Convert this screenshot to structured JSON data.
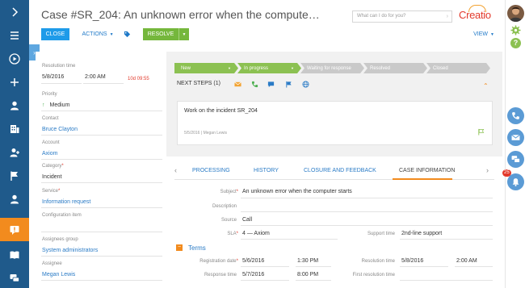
{
  "header": {
    "title": "Case #SR_204: An unknown error when the computer starts",
    "search_placeholder": "What can I do for you?",
    "logo": "Creatio"
  },
  "toolbar": {
    "close_label": "CLOSE",
    "actions_label": "ACTIONS",
    "resolve_label": "RESOLVE",
    "view_label": "VIEW"
  },
  "profile": {
    "resolution_time_label": "Resolution time",
    "resolution_date": "5/8/2016",
    "resolution_time": "2:00 AM",
    "overdue": "10d 09:55",
    "priority_label": "Priority",
    "priority_value": "Medium",
    "contact_label": "Contact",
    "contact_value": "Bruce Clayton",
    "account_label": "Account",
    "account_value": "Axiom",
    "category_label": "Category",
    "category_value": "Incident",
    "service_label": "Service",
    "service_value": "Information request",
    "config_item_label": "Configuration item",
    "assignees_group_label": "Assignees group",
    "assignees_group_value": "System administrators",
    "assignee_label": "Assignee",
    "assignee_value": "Megan Lewis"
  },
  "stages": [
    "New",
    "In progress",
    "Waiting for response",
    "Resolved",
    "Closed"
  ],
  "next_steps": {
    "label": "NEXT STEPS (1)",
    "task_text": "Work on the incident SR_204",
    "task_date": "5/5/2016",
    "task_owner": "Megan Lewis"
  },
  "tabs": [
    "PROCESSING",
    "HISTORY",
    "CLOSURE AND FEEDBACK",
    "CASE INFORMATION"
  ],
  "case_info": {
    "subject_label": "Subject",
    "subject_value": "An unknown error when the computer starts",
    "description_label": "Description",
    "source_label": "Source",
    "source_value": "Call",
    "sla_label": "SLA",
    "sla_value": "4 — Axiom",
    "support_time_label": "Support time",
    "support_time_value": "2nd-line support",
    "terms_title": "Terms",
    "registration_date_label": "Registration date",
    "registration_date": "5/6/2016",
    "registration_time": "1:30 PM",
    "resolution_time_label": "Resolution time",
    "resolution_date": "5/8/2016",
    "resolution_time": "2:00 AM",
    "response_time_label": "Response time",
    "response_date": "5/7/2016",
    "response_time": "8:00 PM",
    "first_resolution_label": "First resolution time"
  },
  "notifications_badge": "25",
  "colors": {
    "nav_bg": "#1f5a8b",
    "nav_active": "#f28b1e",
    "primary_button": "#1e9be9",
    "resolve_button": "#75b73c",
    "stage_done": "#8cc152",
    "stage_todo": "#c9c9c9",
    "link": "#2a7bc6",
    "accent_orange": "#f28b1e"
  },
  "icons": {
    "nav": [
      "chevron-right-icon",
      "menu-icon",
      "play-icon",
      "plus-icon",
      "contact-icon",
      "account-icon",
      "leads-icon",
      "flag-icon",
      "contact-icon",
      "cases-icon",
      "knowledge-icon",
      "chat-icon"
    ]
  }
}
